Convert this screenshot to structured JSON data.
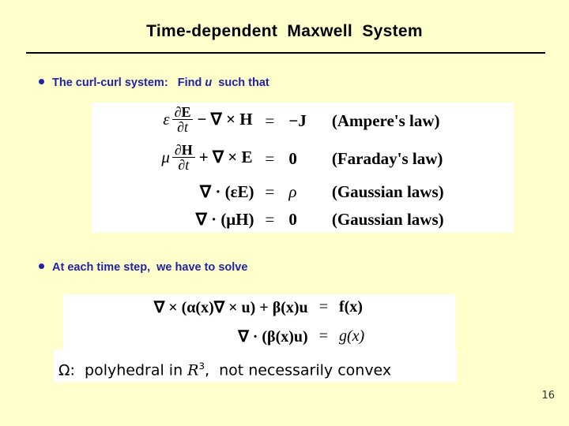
{
  "slide": {
    "title": "Time-dependent  Maxwell  System",
    "page_number": "16",
    "background_color": "#ffffcc",
    "accent_color": "#2222a8"
  },
  "bullets": [
    {
      "id": "bullet-1",
      "marker": "•",
      "text_before": "The curl-curl system:   Find ",
      "italic_var": "u",
      "text_after": "  such that"
    },
    {
      "id": "bullet-2",
      "marker": "•",
      "text_before": "At each time step,  we have to solve",
      "italic_var": "",
      "text_after": ""
    }
  ],
  "equations": {
    "maxwell_system": {
      "rows": [
        {
          "lhs_coeff": "ε",
          "frac_num": "∂E",
          "frac_den": "∂t",
          "lhs_rest": "− ∇ × H",
          "relation": "=",
          "rhs": "−J",
          "note": "(Ampere's law)"
        },
        {
          "lhs_coeff": "μ",
          "frac_num": "∂H",
          "frac_den": "∂t",
          "lhs_rest": "+ ∇ × E",
          "relation": "=",
          "rhs": "0",
          "note": "(Faraday's law)"
        },
        {
          "lhs_coeff": "",
          "frac_num": "",
          "frac_den": "",
          "lhs_rest": "∇ · (εE)",
          "relation": "=",
          "rhs": "ρ",
          "note": "(Gaussian laws)"
        },
        {
          "lhs_coeff": "",
          "frac_num": "",
          "frac_den": "",
          "lhs_rest": "∇ · (μH)",
          "relation": "=",
          "rhs": "0",
          "note": "(Gaussian laws)"
        }
      ]
    },
    "curl_curl_system": {
      "rows": [
        {
          "lhs": "∇ × (α(x)∇ × u) + β(x)u",
          "relation": "=",
          "rhs": "f(x)"
        },
        {
          "lhs": "∇ · (β(x)u)",
          "relation": "=",
          "rhs": "g(x)"
        }
      ]
    },
    "domain_note": {
      "symbol": "Ω",
      "text_before": ":  polyhedral in ",
      "var": "R",
      "exponent": "3",
      "text_after": ",  not necessarily convex"
    }
  }
}
